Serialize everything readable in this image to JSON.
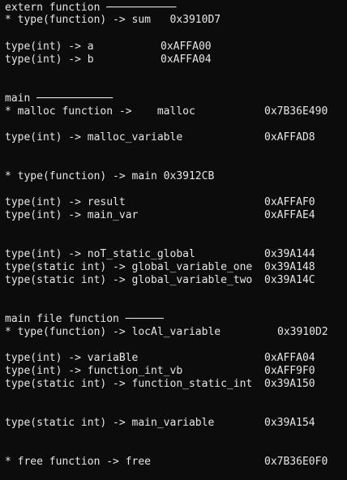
{
  "colors": {
    "background": "#0c0c0c",
    "text": "#e6e6e6"
  },
  "lines": [
    {
      "text": "extern function ───────────",
      "addr": ""
    },
    {
      "text": "* type(function) -> sum   0x3910D7",
      "addr": ""
    },
    {
      "text": "type(int) -> a",
      "addr": "0xAFFA00"
    },
    {
      "text": "type(int) -> b",
      "addr": "0xAFFA04"
    },
    {
      "text": "main ────────────",
      "addr": ""
    },
    {
      "text": "* malloc function ->    malloc",
      "addr": "0x7B36E490"
    },
    {
      "text": "type(int) -> malloc_variable",
      "addr": "0xAFFAD8"
    },
    {
      "text": "* type(function) -> main 0x3912CB",
      "addr": ""
    },
    {
      "text": "type(int) -> result",
      "addr": "0xAFFAF0"
    },
    {
      "text": "type(int) -> main_var",
      "addr": "0xAFFAE4"
    },
    {
      "text": "type(int) -> noT_static_global",
      "addr": "0x39A144"
    },
    {
      "text": "type(static int) -> global_variable_one",
      "addr": "0x39A148"
    },
    {
      "text": "type(static int) -> global_variable_two",
      "addr": "0x39A14C"
    },
    {
      "text": "main file function ──────",
      "addr": ""
    },
    {
      "text": "* type(function) -> locAl_variable",
      "addr": "0x3910D2"
    },
    {
      "text": "type(int) -> variaBle",
      "addr": "0xAFFA04"
    },
    {
      "text": "type(int) -> function_int_vb",
      "addr": "0xAFF9F0"
    },
    {
      "text": "type(static int) -> function_static_int",
      "addr": "0x39A150"
    },
    {
      "text": "type(static int) -> main_variable",
      "addr": "0x39A154"
    },
    {
      "text": "* free function -> free",
      "addr": "0x7B36E0F0"
    }
  ]
}
